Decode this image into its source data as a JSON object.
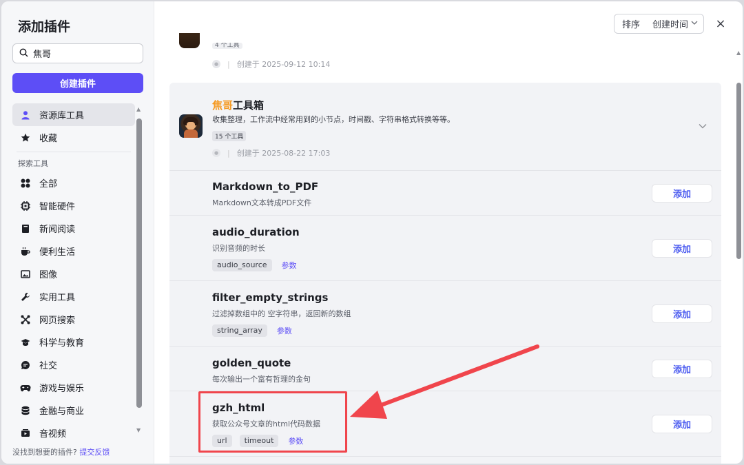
{
  "sidebar": {
    "title": "添加插件",
    "search_value": "焦哥",
    "create_button": "创建插件",
    "top_items": [
      {
        "label": "资源库工具",
        "icon": "user-icon"
      },
      {
        "label": "收藏",
        "icon": "star-icon"
      }
    ],
    "section_label": "探索工具",
    "items": [
      {
        "label": "全部",
        "icon": "grid-icon"
      },
      {
        "label": "智能硬件",
        "icon": "chip-icon"
      },
      {
        "label": "新闻阅读",
        "icon": "book-icon"
      },
      {
        "label": "便利生活",
        "icon": "cup-icon"
      },
      {
        "label": "图像",
        "icon": "image-icon"
      },
      {
        "label": "实用工具",
        "icon": "wrench-icon"
      },
      {
        "label": "网页搜索",
        "icon": "network-icon"
      },
      {
        "label": "科学与教育",
        "icon": "graduation-cap-icon"
      },
      {
        "label": "社交",
        "icon": "chat-icon"
      },
      {
        "label": "游戏与娱乐",
        "icon": "gamepad-icon"
      },
      {
        "label": "金融与商业",
        "icon": "database-icon"
      },
      {
        "label": "音视频",
        "icon": "video-icon"
      }
    ],
    "footer_text": "没找到想要的插件?",
    "footer_link": "提交反馈"
  },
  "header": {
    "sort_label": "排序",
    "sort_value": "创建时间",
    "close_label": "×"
  },
  "prev_plugin": {
    "badge": "4 个工具",
    "created": "创建于 2025-09-12 10:14"
  },
  "plugin": {
    "title_highlight": "焦哥",
    "title_rest": "工具箱",
    "description": "收集整理，工作流中经常用到的小节点，时间戳、字符串格式转换等等。",
    "tool_count": "15 个工具",
    "created": "创建于 2025-08-22 17:03",
    "tools": [
      {
        "name": "Markdown_to_PDF",
        "desc": "Markdown文本转成PDF文件",
        "params": [],
        "param_link": "",
        "add": "添加"
      },
      {
        "name": "audio_duration",
        "desc": "识别音频的时长",
        "params": [
          "audio_source"
        ],
        "param_link": "参数",
        "add": "添加"
      },
      {
        "name": "filter_empty_strings",
        "desc": "过滤掉数组中的 空字符串，返回新的数组",
        "params": [
          "string_array"
        ],
        "param_link": "参数",
        "add": "添加"
      },
      {
        "name": "golden_quote",
        "desc": "每次输出一个富有哲理的金句",
        "params": [],
        "param_link": "",
        "add": "添加"
      },
      {
        "name": "gzh_html",
        "desc": "获取公众号文章的html代码数据",
        "params": [
          "url",
          "timeout"
        ],
        "param_link": "参数",
        "add": "添加"
      }
    ]
  },
  "colors": {
    "accent": "#5d4ef6",
    "highlight": "#f59a23",
    "annotation": "#f0454c"
  }
}
